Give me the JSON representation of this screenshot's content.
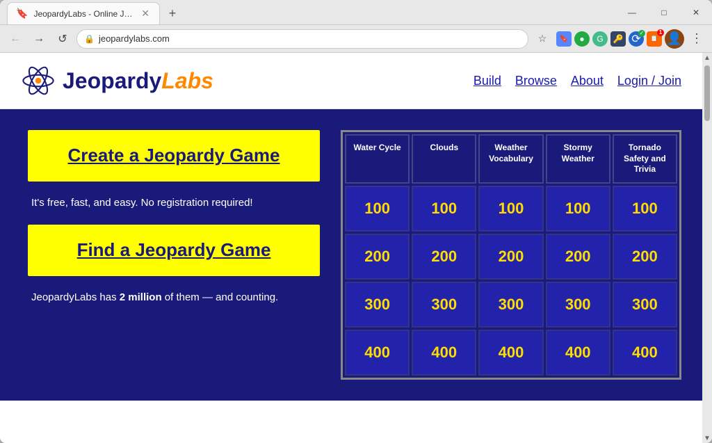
{
  "browser": {
    "tab_label": "JeopardyLabs - Online Jeopardy",
    "url": "jeopardylabs.com",
    "new_tab_icon": "+",
    "back_icon": "←",
    "forward_icon": "→",
    "reload_icon": "↺",
    "minimize_icon": "—",
    "maximize_icon": "□",
    "close_icon": "✕",
    "star_icon": "☆",
    "lock_icon": "🔒",
    "menu_icon": "⋮"
  },
  "site": {
    "logo_text_1": "Jeopardy",
    "logo_text_2": "Labs",
    "nav": {
      "build": "Build",
      "browse": "Browse",
      "about": "About",
      "login": "Login / Join"
    }
  },
  "hero": {
    "create_btn": "Create a Jeopardy Game",
    "create_desc": "It's free, fast, and easy. No registration required!",
    "find_btn": "Find a Jeopardy Game",
    "find_desc_1": "JeopardyLabs has ",
    "find_desc_bold": "2 million",
    "find_desc_2": " of them — and counting."
  },
  "board": {
    "categories": [
      "Water Cycle",
      "Clouds",
      "Weather Vocabulary",
      "Stormy Weather",
      "Tornado Safety and Trivia"
    ],
    "rows": [
      [
        "100",
        "100",
        "100",
        "100",
        "100"
      ],
      [
        "200",
        "200",
        "200",
        "200",
        "200"
      ],
      [
        "300",
        "300",
        "300",
        "300",
        "300"
      ],
      [
        "400",
        "400",
        "400",
        "400",
        "400"
      ]
    ]
  }
}
